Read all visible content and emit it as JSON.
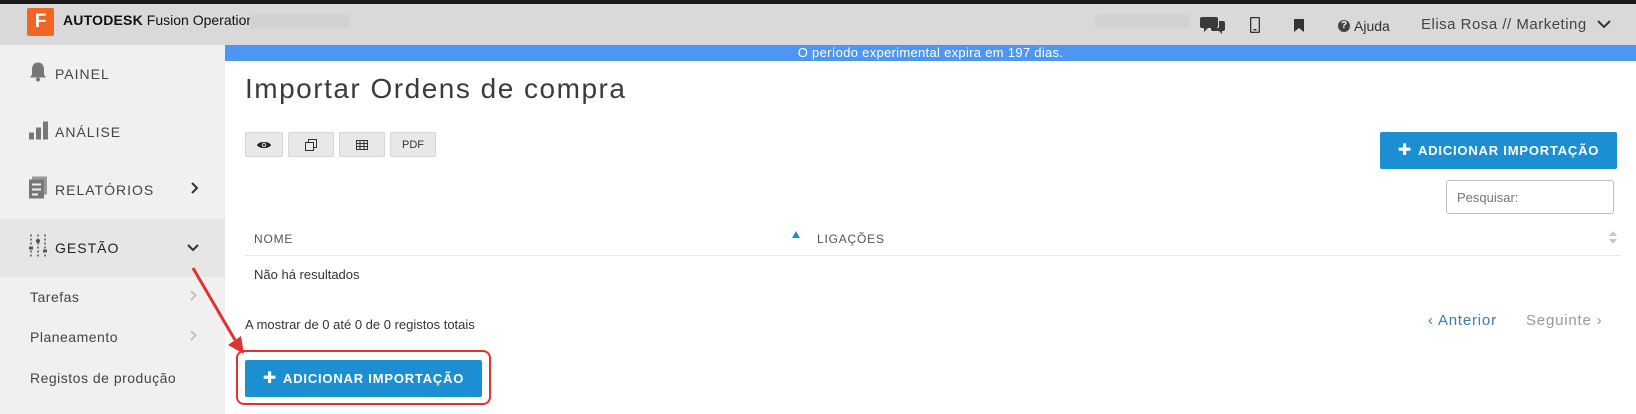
{
  "app": {
    "logo_letter": "F",
    "brand_bold": "AUTODESK",
    "brand_name": "Fusion Operations",
    "help_label": "Ajuda",
    "user_label": "Elisa Rosa // Marketing"
  },
  "icons": {
    "chat": "chat-icon",
    "phone": "phone-icon",
    "bookmark": "bookmark-icon",
    "help": "help-icon",
    "user_menu": "chevron-down-icon"
  },
  "sidebar": {
    "items": [
      {
        "label": "PAINEL",
        "icon": "bell-icon"
      },
      {
        "label": "ANÁLISE",
        "icon": "bar-chart-icon"
      },
      {
        "label": "RELATÓRIOS",
        "icon": "report-icon"
      },
      {
        "label": "GESTÃO",
        "icon": "sliders-icon"
      }
    ],
    "subitems": [
      {
        "label": "Tarefas"
      },
      {
        "label": "Planeamento"
      },
      {
        "label": "Registos de produção"
      }
    ]
  },
  "banner": {
    "text": "O período experimental expira em 197 dias."
  },
  "main": {
    "title": "Importar Ordens de compra",
    "toolbar": {
      "pdf_label": "PDF"
    },
    "add_import_label": "ADICIONAR IMPORTAÇÃO",
    "search": {
      "placeholder": "Pesquisar:"
    },
    "table": {
      "columns": [
        "NOME",
        "LIGAÇÕES"
      ],
      "empty_text": "Não há resultados"
    },
    "info_text": "A mostrar de 0 até 0 de 0 registos totais",
    "pager": {
      "prev": "Anterior",
      "next": "Seguinte"
    }
  },
  "colors": {
    "primary": "#1b8fd1",
    "banner": "#4e96f1",
    "highlight": "#e0322e",
    "logo": "#f26522"
  }
}
